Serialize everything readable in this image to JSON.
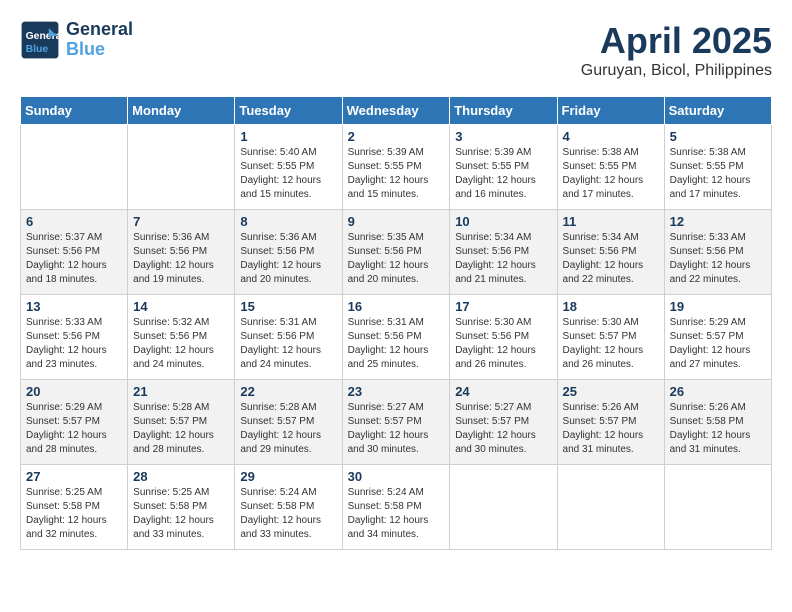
{
  "logo": {
    "line1": "General",
    "line2": "Blue"
  },
  "title": "April 2025",
  "subtitle": "Guruyan, Bicol, Philippines",
  "headers": [
    "Sunday",
    "Monday",
    "Tuesday",
    "Wednesday",
    "Thursday",
    "Friday",
    "Saturday"
  ],
  "weeks": [
    [
      {
        "day": "",
        "info": ""
      },
      {
        "day": "",
        "info": ""
      },
      {
        "day": "1",
        "sunrise": "Sunrise: 5:40 AM",
        "sunset": "Sunset: 5:55 PM",
        "daylight": "Daylight: 12 hours and 15 minutes."
      },
      {
        "day": "2",
        "sunrise": "Sunrise: 5:39 AM",
        "sunset": "Sunset: 5:55 PM",
        "daylight": "Daylight: 12 hours and 15 minutes."
      },
      {
        "day": "3",
        "sunrise": "Sunrise: 5:39 AM",
        "sunset": "Sunset: 5:55 PM",
        "daylight": "Daylight: 12 hours and 16 minutes."
      },
      {
        "day": "4",
        "sunrise": "Sunrise: 5:38 AM",
        "sunset": "Sunset: 5:55 PM",
        "daylight": "Daylight: 12 hours and 17 minutes."
      },
      {
        "day": "5",
        "sunrise": "Sunrise: 5:38 AM",
        "sunset": "Sunset: 5:55 PM",
        "daylight": "Daylight: 12 hours and 17 minutes."
      }
    ],
    [
      {
        "day": "6",
        "sunrise": "Sunrise: 5:37 AM",
        "sunset": "Sunset: 5:56 PM",
        "daylight": "Daylight: 12 hours and 18 minutes."
      },
      {
        "day": "7",
        "sunrise": "Sunrise: 5:36 AM",
        "sunset": "Sunset: 5:56 PM",
        "daylight": "Daylight: 12 hours and 19 minutes."
      },
      {
        "day": "8",
        "sunrise": "Sunrise: 5:36 AM",
        "sunset": "Sunset: 5:56 PM",
        "daylight": "Daylight: 12 hours and 20 minutes."
      },
      {
        "day": "9",
        "sunrise": "Sunrise: 5:35 AM",
        "sunset": "Sunset: 5:56 PM",
        "daylight": "Daylight: 12 hours and 20 minutes."
      },
      {
        "day": "10",
        "sunrise": "Sunrise: 5:34 AM",
        "sunset": "Sunset: 5:56 PM",
        "daylight": "Daylight: 12 hours and 21 minutes."
      },
      {
        "day": "11",
        "sunrise": "Sunrise: 5:34 AM",
        "sunset": "Sunset: 5:56 PM",
        "daylight": "Daylight: 12 hours and 22 minutes."
      },
      {
        "day": "12",
        "sunrise": "Sunrise: 5:33 AM",
        "sunset": "Sunset: 5:56 PM",
        "daylight": "Daylight: 12 hours and 22 minutes."
      }
    ],
    [
      {
        "day": "13",
        "sunrise": "Sunrise: 5:33 AM",
        "sunset": "Sunset: 5:56 PM",
        "daylight": "Daylight: 12 hours and 23 minutes."
      },
      {
        "day": "14",
        "sunrise": "Sunrise: 5:32 AM",
        "sunset": "Sunset: 5:56 PM",
        "daylight": "Daylight: 12 hours and 24 minutes."
      },
      {
        "day": "15",
        "sunrise": "Sunrise: 5:31 AM",
        "sunset": "Sunset: 5:56 PM",
        "daylight": "Daylight: 12 hours and 24 minutes."
      },
      {
        "day": "16",
        "sunrise": "Sunrise: 5:31 AM",
        "sunset": "Sunset: 5:56 PM",
        "daylight": "Daylight: 12 hours and 25 minutes."
      },
      {
        "day": "17",
        "sunrise": "Sunrise: 5:30 AM",
        "sunset": "Sunset: 5:56 PM",
        "daylight": "Daylight: 12 hours and 26 minutes."
      },
      {
        "day": "18",
        "sunrise": "Sunrise: 5:30 AM",
        "sunset": "Sunset: 5:57 PM",
        "daylight": "Daylight: 12 hours and 26 minutes."
      },
      {
        "day": "19",
        "sunrise": "Sunrise: 5:29 AM",
        "sunset": "Sunset: 5:57 PM",
        "daylight": "Daylight: 12 hours and 27 minutes."
      }
    ],
    [
      {
        "day": "20",
        "sunrise": "Sunrise: 5:29 AM",
        "sunset": "Sunset: 5:57 PM",
        "daylight": "Daylight: 12 hours and 28 minutes."
      },
      {
        "day": "21",
        "sunrise": "Sunrise: 5:28 AM",
        "sunset": "Sunset: 5:57 PM",
        "daylight": "Daylight: 12 hours and 28 minutes."
      },
      {
        "day": "22",
        "sunrise": "Sunrise: 5:28 AM",
        "sunset": "Sunset: 5:57 PM",
        "daylight": "Daylight: 12 hours and 29 minutes."
      },
      {
        "day": "23",
        "sunrise": "Sunrise: 5:27 AM",
        "sunset": "Sunset: 5:57 PM",
        "daylight": "Daylight: 12 hours and 30 minutes."
      },
      {
        "day": "24",
        "sunrise": "Sunrise: 5:27 AM",
        "sunset": "Sunset: 5:57 PM",
        "daylight": "Daylight: 12 hours and 30 minutes."
      },
      {
        "day": "25",
        "sunrise": "Sunrise: 5:26 AM",
        "sunset": "Sunset: 5:57 PM",
        "daylight": "Daylight: 12 hours and 31 minutes."
      },
      {
        "day": "26",
        "sunrise": "Sunrise: 5:26 AM",
        "sunset": "Sunset: 5:58 PM",
        "daylight": "Daylight: 12 hours and 31 minutes."
      }
    ],
    [
      {
        "day": "27",
        "sunrise": "Sunrise: 5:25 AM",
        "sunset": "Sunset: 5:58 PM",
        "daylight": "Daylight: 12 hours and 32 minutes."
      },
      {
        "day": "28",
        "sunrise": "Sunrise: 5:25 AM",
        "sunset": "Sunset: 5:58 PM",
        "daylight": "Daylight: 12 hours and 33 minutes."
      },
      {
        "day": "29",
        "sunrise": "Sunrise: 5:24 AM",
        "sunset": "Sunset: 5:58 PM",
        "daylight": "Daylight: 12 hours and 33 minutes."
      },
      {
        "day": "30",
        "sunrise": "Sunrise: 5:24 AM",
        "sunset": "Sunset: 5:58 PM",
        "daylight": "Daylight: 12 hours and 34 minutes."
      },
      {
        "day": "",
        "info": ""
      },
      {
        "day": "",
        "info": ""
      },
      {
        "day": "",
        "info": ""
      }
    ]
  ]
}
